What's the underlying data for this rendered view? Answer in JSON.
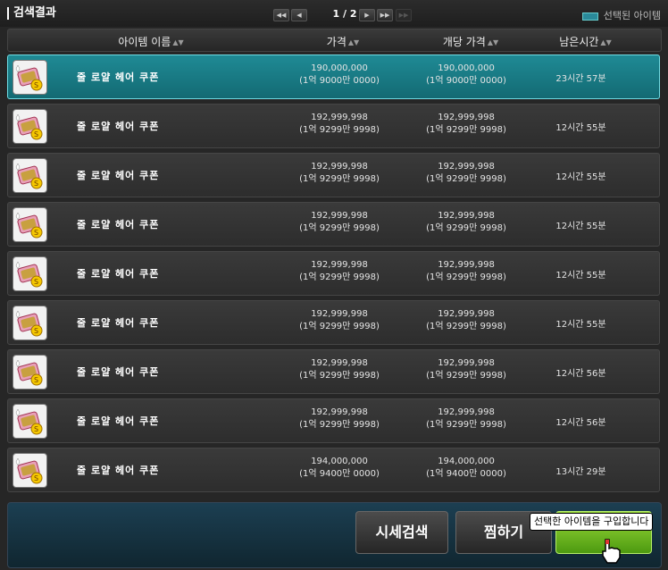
{
  "window": {
    "title": "검색결과"
  },
  "pager": {
    "text": "1 / 2",
    "first_icon": "first-page-icon",
    "prev_icon": "prev-page-icon",
    "next_icon": "next-page-icon",
    "last_icon": "last-page-icon"
  },
  "legend": {
    "label": "선택된 아이템",
    "color": "#2a8a9a"
  },
  "columns": {
    "name": "아이템 이름",
    "price": "가격",
    "unit_price": "개당 가격",
    "remaining": "남은시간"
  },
  "rows": [
    {
      "name": "줄 로얄 헤어 쿠폰",
      "price": "190,000,000",
      "price_kr": "(1억 9000만 0000)",
      "unit": "190,000,000",
      "unit_kr": "(1억 9000만 0000)",
      "time": "23시간 57분",
      "selected": true
    },
    {
      "name": "줄 로얄 헤어 쿠폰",
      "price": "192,999,998",
      "price_kr": "(1억 9299만 9998)",
      "unit": "192,999,998",
      "unit_kr": "(1억 9299만 9998)",
      "time": "12시간 55분"
    },
    {
      "name": "줄 로얄 헤어 쿠폰",
      "price": "192,999,998",
      "price_kr": "(1억 9299만 9998)",
      "unit": "192,999,998",
      "unit_kr": "(1억 9299만 9998)",
      "time": "12시간 55분"
    },
    {
      "name": "줄 로얄 헤어 쿠폰",
      "price": "192,999,998",
      "price_kr": "(1억 9299만 9998)",
      "unit": "192,999,998",
      "unit_kr": "(1억 9299만 9998)",
      "time": "12시간 55분"
    },
    {
      "name": "줄 로얄 헤어 쿠폰",
      "price": "192,999,998",
      "price_kr": "(1억 9299만 9998)",
      "unit": "192,999,998",
      "unit_kr": "(1억 9299만 9998)",
      "time": "12시간 55분"
    },
    {
      "name": "줄 로얄 헤어 쿠폰",
      "price": "192,999,998",
      "price_kr": "(1억 9299만 9998)",
      "unit": "192,999,998",
      "unit_kr": "(1억 9299만 9998)",
      "time": "12시간 55분"
    },
    {
      "name": "줄 로얄 헤어 쿠폰",
      "price": "192,999,998",
      "price_kr": "(1억 9299만 9998)",
      "unit": "192,999,998",
      "unit_kr": "(1억 9299만 9998)",
      "time": "12시간 56분"
    },
    {
      "name": "줄 로얄 헤어 쿠폰",
      "price": "192,999,998",
      "price_kr": "(1억 9299만 9998)",
      "unit": "192,999,998",
      "unit_kr": "(1억 9299만 9998)",
      "time": "12시간 56분"
    },
    {
      "name": "줄 로얄 헤어 쿠폰",
      "price": "194,000,000",
      "price_kr": "(1억 9400만 0000)",
      "unit": "194,000,000",
      "unit_kr": "(1억 9400만 0000)",
      "time": "13시간 29분"
    }
  ],
  "buttons": {
    "market_search": "시세검색",
    "wishlist": "찜하기"
  },
  "tooltip": {
    "text": "선택한 아이템을 구입합니다"
  },
  "colors": {
    "selected_row": "#1f8a95",
    "buy_button": "#7cc227"
  }
}
